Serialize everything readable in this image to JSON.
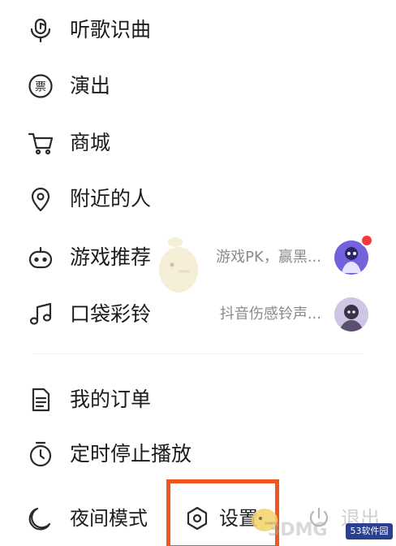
{
  "menu": {
    "items": [
      {
        "label": "听歌识曲",
        "icon": "microphone-note-icon"
      },
      {
        "label": "演出",
        "icon": "ticket-icon",
        "icon_text": "票"
      },
      {
        "label": "商城",
        "icon": "shopping-cart-icon"
      },
      {
        "label": "附近的人",
        "icon": "location-pin-icon"
      },
      {
        "label": "游戏推荐",
        "icon": "game-controller-icon",
        "sub": "游戏PK，赢黑...",
        "has_badge": true
      },
      {
        "label": "口袋彩铃",
        "icon": "music-note-icon",
        "sub": "抖音伤感铃声..."
      },
      {
        "label": "我的订单",
        "icon": "order-document-icon"
      },
      {
        "label": "定时停止播放",
        "icon": "timer-icon"
      }
    ]
  },
  "bottom_bar": {
    "night_mode": "夜间模式",
    "settings": "设置",
    "exit": "退出"
  },
  "watermark": {
    "text": "3DMG",
    "badge": "53软件园"
  },
  "colors": {
    "highlight": "#f0561e",
    "badge_red": "#f23a3a",
    "text": "#1c1c1c",
    "subtext": "#8a8a8a"
  }
}
